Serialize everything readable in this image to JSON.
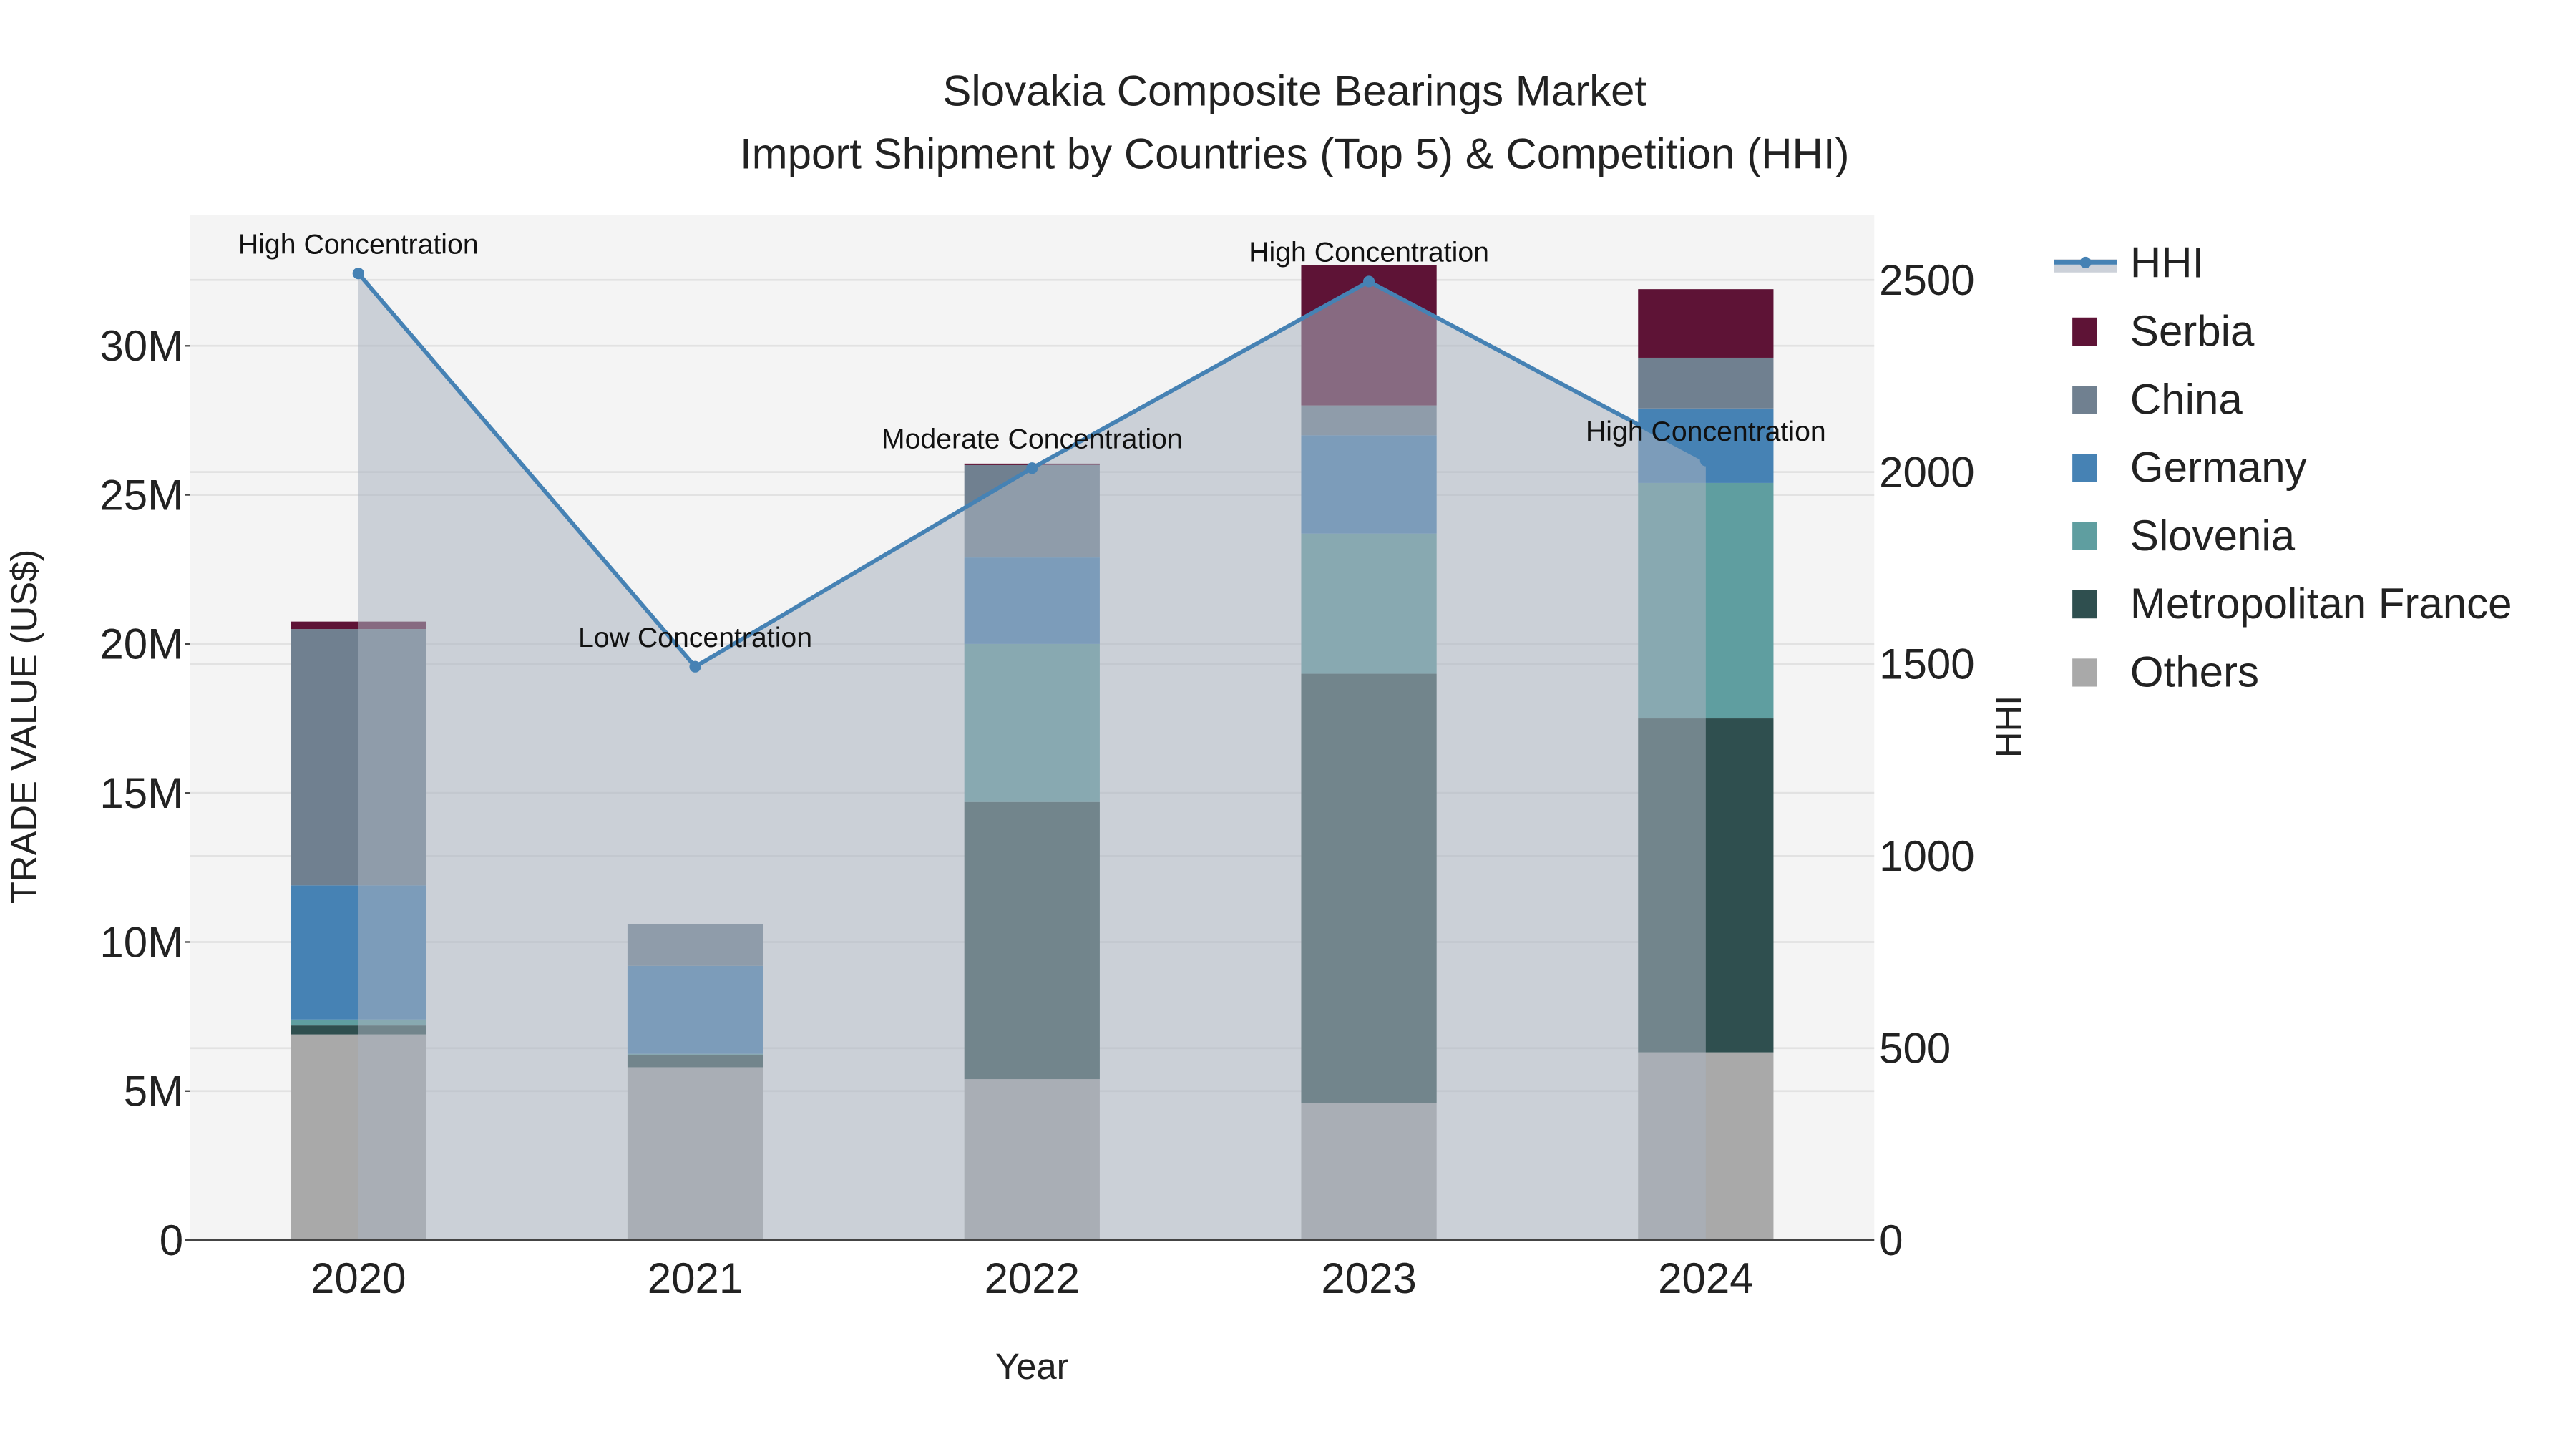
{
  "chart_data": {
    "type": "bar",
    "stacked": true,
    "title": "Slovakia Composite Bearings Market",
    "subtitle": "Import Shipment by Countries (Top 5) & Competition (HHI)",
    "xlabel": "Year",
    "ylabel": "TRADE VALUE (US$)",
    "y2label": "HHI",
    "categories": [
      "2020",
      "2021",
      "2022",
      "2023",
      "2024"
    ],
    "ylim": [
      0,
      34.4
    ],
    "y2lim": [
      0,
      2670
    ],
    "yticks": [
      0,
      5,
      10,
      15,
      20,
      25,
      30
    ],
    "ytick_labels": [
      "0",
      "5M",
      "10M",
      "15M",
      "20M",
      "25M",
      "30M"
    ],
    "y2ticks": [
      0,
      500,
      1000,
      1500,
      2000,
      2500
    ],
    "y2tick_labels": [
      "0",
      "500",
      "1000",
      "1500",
      "2000",
      "2500"
    ],
    "series": [
      {
        "name": "Others",
        "color": "#a9a9a9",
        "values": [
          6.9,
          5.8,
          5.4,
          4.6,
          6.3
        ]
      },
      {
        "name": "Metropolitan France",
        "color": "#2f4f4f",
        "values": [
          0.3,
          0.4,
          9.3,
          14.4,
          11.2
        ]
      },
      {
        "name": "Slovenia",
        "color": "#5f9ea0",
        "values": [
          0.2,
          0.05,
          5.3,
          4.7,
          7.9
        ]
      },
      {
        "name": "Germany",
        "color": "#4682b4",
        "values": [
          4.5,
          2.95,
          2.9,
          3.3,
          2.5
        ]
      },
      {
        "name": "China",
        "color": "#708090",
        "values": [
          8.6,
          1.4,
          3.1,
          1.0,
          1.7
        ]
      },
      {
        "name": "Serbia",
        "color": "#5e1336",
        "values": [
          0.25,
          0,
          0.05,
          4.7,
          2.3
        ]
      }
    ],
    "hhi": {
      "name": "HHI",
      "color": "#4682b4",
      "values": [
        2517,
        1493,
        2010,
        2496,
        2030
      ],
      "annotations": [
        "High Concentration",
        "Low Concentration",
        "Moderate Concentration",
        "High Concentration",
        "High Concentration"
      ]
    },
    "legend_order": [
      "HHI",
      "Serbia",
      "China",
      "Germany",
      "Slovenia",
      "Metropolitan France",
      "Others"
    ],
    "legend_position": "right",
    "grid": true
  }
}
